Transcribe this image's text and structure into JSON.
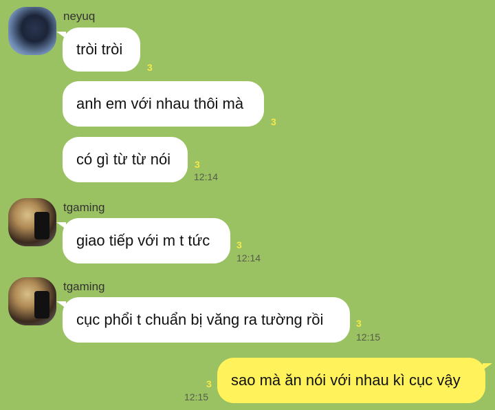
{
  "colors": {
    "background": "#9bc262",
    "bubble_incoming": "#ffffff",
    "bubble_outgoing": "#fff25a",
    "read_count": "#f5e84a"
  },
  "messages": [
    {
      "sender": "neyuq",
      "text": "tròi tròi",
      "read": "3",
      "time": ""
    },
    {
      "sender": "neyuq",
      "text": "anh em với nhau thôi mà",
      "read": "3",
      "time": ""
    },
    {
      "sender": "neyuq",
      "text": "có gì từ từ nói",
      "read": "3",
      "time": "12:14"
    },
    {
      "sender": "tgaming",
      "text": "giao tiếp với m t tức",
      "read": "3",
      "time": "12:14"
    },
    {
      "sender": "tgaming",
      "text": "cục phổi t chuẩn bị văng ra tường rồi",
      "read": "3",
      "time": "12:15"
    },
    {
      "sender": "me",
      "text": "sao mà ăn nói với nhau kì cục vậy",
      "read": "3",
      "time": "12:15"
    }
  ]
}
